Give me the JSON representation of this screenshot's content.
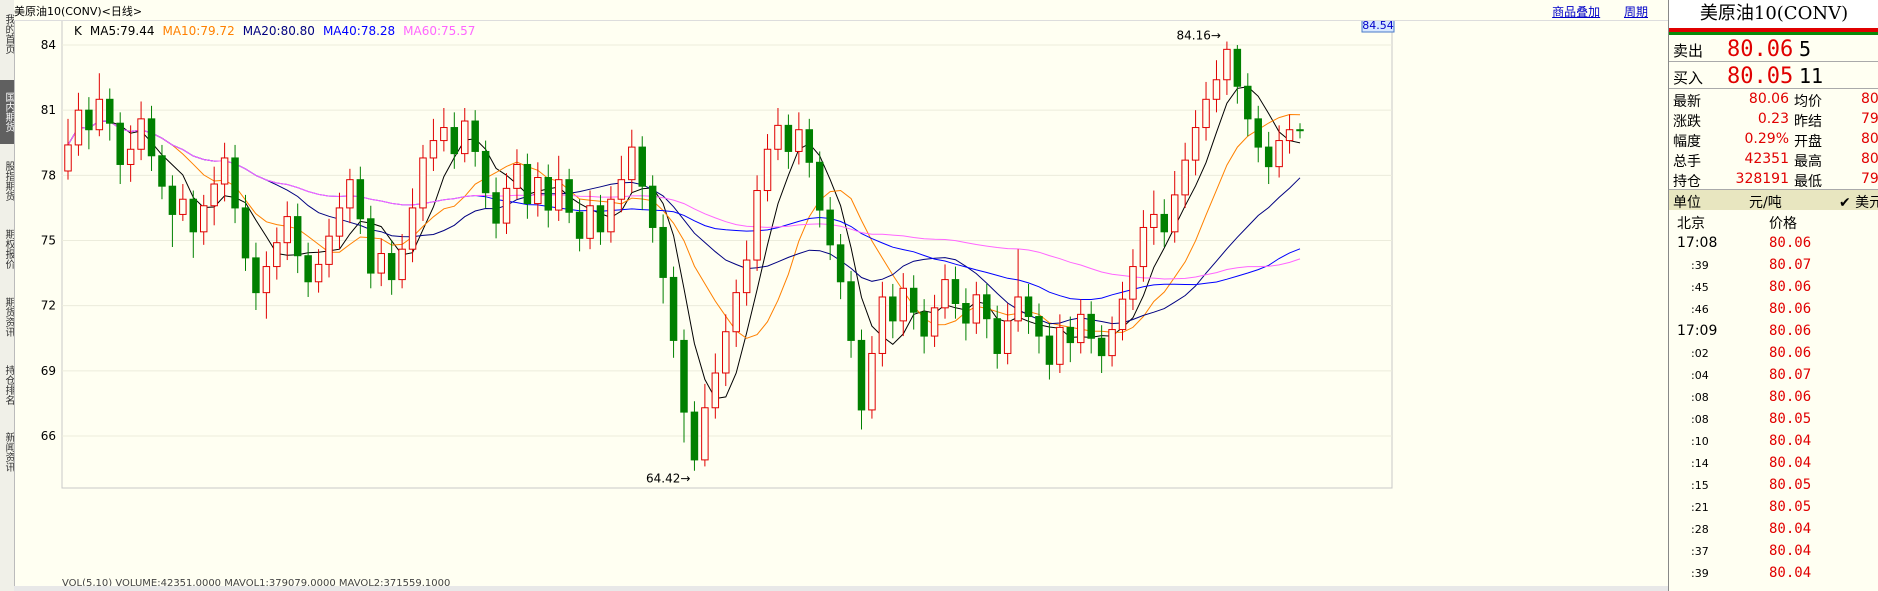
{
  "left_tabs": [
    {
      "label": "我的首页"
    },
    {
      "label": "国内期货",
      "active": true
    },
    {
      "label": "股指期货"
    },
    {
      "label": "期权报价"
    },
    {
      "label": "期货资讯"
    },
    {
      "label": "持仓排名"
    },
    {
      "label": "新闻资讯"
    }
  ],
  "header": {
    "title": "美原油10(CONV)<日线>",
    "links": [
      "商品叠加",
      "周期"
    ]
  },
  "ma_legend": [
    {
      "label": "K",
      "color": "#000000"
    },
    {
      "label": "MA5:79.44",
      "color": "#000000"
    },
    {
      "label": "MA10:79.72",
      "color": "#ff8000"
    },
    {
      "label": "MA20:80.80",
      "color": "#000080"
    },
    {
      "label": "MA40:78.28",
      "color": "#0000ff"
    },
    {
      "label": "MA60:75.57",
      "color": "#ff66ff"
    }
  ],
  "price_axis": {
    "ticks": [
      "84",
      "81",
      "78",
      "75",
      "72",
      "69",
      "66"
    ],
    "current_price_label": "84.54"
  },
  "annotations": {
    "high_label": "84.16",
    "low_label": "64.42"
  },
  "bottom_strip_text": "VOL(5,10) VOLUME:42351.0000 MAVOL1:379079.0000 MAVOL2:371559.1000",
  "colors": {
    "up": "#e00000",
    "down": "#008000",
    "accent_blue": "#0000c8"
  },
  "chart_data": {
    "type": "candlestick",
    "ylim": [
      64,
      85
    ],
    "yticks": [
      84,
      81,
      78,
      75,
      72,
      69,
      66
    ],
    "highest": 84.16,
    "lowest": 64.42,
    "candles": [
      [
        78.2,
        79.4,
        80.6,
        77.8
      ],
      [
        79.4,
        81.0,
        81.8,
        78.9
      ],
      [
        81.0,
        80.1,
        81.6,
        79.2
      ],
      [
        80.1,
        81.5,
        82.7,
        79.8
      ],
      [
        81.5,
        80.4,
        82.0,
        79.6
      ],
      [
        80.4,
        78.5,
        80.9,
        77.6
      ],
      [
        78.5,
        79.2,
        80.3,
        77.7
      ],
      [
        79.2,
        80.6,
        81.4,
        78.7
      ],
      [
        80.6,
        78.9,
        81.2,
        78.2
      ],
      [
        78.9,
        77.5,
        79.4,
        76.9
      ],
      [
        77.5,
        76.2,
        78.0,
        74.7
      ],
      [
        76.2,
        76.9,
        77.6,
        75.9
      ],
      [
        76.9,
        75.4,
        77.3,
        74.2
      ],
      [
        75.4,
        76.6,
        77.1,
        74.8
      ],
      [
        76.6,
        77.6,
        78.4,
        75.7
      ],
      [
        77.6,
        78.8,
        79.5,
        76.8
      ],
      [
        78.8,
        76.5,
        79.4,
        75.8
      ],
      [
        76.5,
        74.2,
        77.1,
        73.6
      ],
      [
        74.2,
        72.6,
        74.9,
        71.8
      ],
      [
        72.6,
        73.8,
        74.5,
        71.4
      ],
      [
        73.8,
        74.9,
        75.6,
        73.2
      ],
      [
        74.9,
        76.1,
        76.8,
        74.1
      ],
      [
        76.1,
        74.3,
        76.7,
        73.5
      ],
      [
        74.3,
        73.1,
        74.9,
        72.4
      ],
      [
        73.1,
        73.9,
        74.6,
        72.6
      ],
      [
        73.9,
        75.2,
        76.0,
        73.3
      ],
      [
        75.2,
        76.5,
        77.2,
        74.6
      ],
      [
        76.5,
        77.8,
        78.3,
        75.8
      ],
      [
        77.8,
        76.0,
        78.4,
        75.3
      ],
      [
        76.0,
        73.5,
        76.6,
        72.8
      ],
      [
        73.5,
        74.4,
        75.1,
        72.9
      ],
      [
        74.4,
        73.2,
        75.0,
        72.5
      ],
      [
        73.2,
        74.6,
        75.3,
        72.8
      ],
      [
        74.6,
        76.5,
        77.4,
        74.0
      ],
      [
        76.5,
        78.8,
        79.4,
        75.9
      ],
      [
        78.8,
        79.6,
        80.6,
        78.2
      ],
      [
        79.6,
        80.2,
        81.1,
        79.1
      ],
      [
        80.2,
        79.0,
        80.9,
        78.3
      ],
      [
        79.0,
        80.5,
        81.1,
        78.6
      ],
      [
        80.5,
        79.1,
        81.0,
        78.4
      ],
      [
        79.1,
        77.2,
        79.6,
        76.5
      ],
      [
        77.2,
        75.8,
        77.9,
        75.1
      ],
      [
        75.8,
        77.4,
        78.1,
        75.3
      ],
      [
        77.4,
        78.5,
        79.2,
        76.9
      ],
      [
        78.5,
        76.7,
        79.0,
        76.0
      ],
      [
        76.7,
        77.9,
        78.6,
        76.1
      ],
      [
        77.9,
        76.4,
        78.5,
        75.6
      ],
      [
        76.4,
        77.8,
        78.9,
        75.9
      ],
      [
        77.8,
        76.3,
        78.3,
        75.8
      ],
      [
        76.3,
        75.1,
        76.9,
        74.5
      ],
      [
        75.1,
        76.6,
        77.3,
        74.6
      ],
      [
        76.6,
        75.4,
        77.1,
        74.8
      ],
      [
        75.4,
        76.9,
        77.5,
        74.9
      ],
      [
        76.9,
        77.8,
        78.9,
        76.3
      ],
      [
        77.8,
        79.3,
        80.1,
        77.2
      ],
      [
        79.3,
        77.5,
        79.8,
        76.4
      ],
      [
        77.5,
        75.6,
        78.0,
        74.9
      ],
      [
        75.6,
        73.3,
        76.2,
        72.1
      ],
      [
        73.3,
        70.4,
        73.8,
        69.6
      ],
      [
        70.4,
        67.1,
        70.9,
        65.7
      ],
      [
        67.1,
        64.9,
        67.6,
        64.4
      ],
      [
        64.9,
        67.3,
        68.4,
        64.6
      ],
      [
        67.3,
        68.9,
        69.8,
        66.8
      ],
      [
        68.9,
        70.8,
        71.6,
        68.3
      ],
      [
        70.8,
        72.6,
        73.2,
        70.1
      ],
      [
        72.6,
        74.1,
        75.0,
        72.0
      ],
      [
        74.1,
        77.3,
        78.0,
        73.6
      ],
      [
        77.3,
        79.2,
        79.9,
        76.8
      ],
      [
        79.2,
        80.3,
        81.1,
        78.7
      ],
      [
        80.3,
        79.1,
        80.8,
        78.3
      ],
      [
        79.1,
        80.1,
        80.9,
        78.5
      ],
      [
        80.1,
        78.6,
        80.6,
        77.9
      ],
      [
        78.6,
        76.4,
        79.1,
        75.6
      ],
      [
        76.4,
        74.8,
        77.0,
        74.1
      ],
      [
        74.8,
        73.1,
        75.3,
        72.3
      ],
      [
        73.1,
        70.4,
        73.6,
        69.6
      ],
      [
        70.4,
        67.2,
        70.9,
        66.3
      ],
      [
        67.2,
        69.8,
        70.6,
        66.8
      ],
      [
        69.8,
        72.4,
        73.1,
        69.2
      ],
      [
        72.4,
        71.3,
        73.0,
        70.5
      ],
      [
        71.3,
        72.8,
        73.5,
        70.6
      ],
      [
        72.8,
        71.7,
        73.4,
        70.9
      ],
      [
        71.7,
        70.6,
        72.3,
        69.8
      ],
      [
        70.6,
        71.9,
        72.5,
        70.1
      ],
      [
        71.9,
        73.2,
        73.9,
        71.4
      ],
      [
        73.2,
        72.1,
        73.8,
        71.4
      ],
      [
        72.1,
        71.2,
        72.8,
        70.4
      ],
      [
        71.2,
        72.5,
        73.1,
        70.7
      ],
      [
        72.5,
        71.4,
        73.0,
        70.5
      ],
      [
        71.4,
        69.8,
        72.0,
        69.1
      ],
      [
        69.8,
        71.3,
        72.1,
        69.3
      ],
      [
        71.3,
        72.4,
        74.6,
        70.8
      ],
      [
        72.4,
        71.5,
        73.0,
        70.7
      ],
      [
        71.5,
        70.6,
        72.1,
        69.8
      ],
      [
        70.6,
        69.3,
        71.2,
        68.6
      ],
      [
        69.3,
        71.0,
        71.6,
        68.9
      ],
      [
        71.0,
        70.3,
        71.5,
        69.4
      ],
      [
        70.3,
        71.6,
        72.3,
        69.8
      ],
      [
        71.6,
        70.5,
        72.2,
        69.8
      ],
      [
        70.5,
        69.7,
        71.1,
        68.9
      ],
      [
        69.7,
        70.9,
        71.5,
        69.2
      ],
      [
        70.9,
        72.3,
        73.1,
        70.4
      ],
      [
        72.3,
        73.8,
        74.6,
        71.8
      ],
      [
        73.8,
        75.6,
        76.4,
        73.1
      ],
      [
        75.6,
        76.2,
        77.3,
        74.8
      ],
      [
        76.2,
        75.4,
        76.9,
        74.7
      ],
      [
        75.4,
        77.1,
        78.2,
        74.9
      ],
      [
        77.1,
        78.7,
        79.5,
        76.5
      ],
      [
        78.7,
        80.2,
        81.0,
        78.0
      ],
      [
        80.2,
        81.5,
        82.3,
        79.6
      ],
      [
        81.5,
        82.4,
        83.3,
        80.9
      ],
      [
        82.4,
        83.8,
        84.16,
        81.7
      ],
      [
        83.8,
        82.1,
        84.0,
        81.3
      ],
      [
        82.1,
        80.6,
        82.7,
        79.8
      ],
      [
        80.6,
        79.3,
        81.2,
        78.6
      ],
      [
        79.3,
        78.4,
        80.0,
        77.6
      ],
      [
        78.4,
        79.6,
        80.3,
        77.9
      ],
      [
        79.6,
        80.1,
        80.8,
        79.0
      ],
      [
        80.1,
        80.06,
        80.4,
        79.7
      ]
    ]
  },
  "quote": {
    "symbol": "美原油10(CONV)",
    "sell": {
      "label": "卖出",
      "price": "80.06",
      "vol": "5"
    },
    "buy": {
      "label": "买入",
      "price": "80.05",
      "vol": "11"
    },
    "stats": [
      {
        "l1": "最新",
        "v1": "80.06",
        "l2": "均价",
        "v2": "80"
      },
      {
        "l1": "涨跌",
        "v1": "0.23",
        "l2": "昨结",
        "v2": "79"
      },
      {
        "l1": "幅度",
        "v1": "0.29%",
        "l2": "开盘",
        "v2": "80"
      },
      {
        "l1": "总手",
        "v1": "42351",
        "l2": "最高",
        "v2": "80"
      },
      {
        "l1": "持仓",
        "v1": "328191",
        "l2": "最低",
        "v2": "79"
      }
    ],
    "unit_label": "单位",
    "unit_value": "元/吨",
    "currency": "✔ 美元",
    "city": "北京",
    "price_header": "价格",
    "ticks": [
      {
        "t": "17:08",
        "p": "80.06",
        "small": false
      },
      {
        "t": ":39",
        "p": "80.07",
        "small": true
      },
      {
        "t": ":45",
        "p": "80.06",
        "small": true
      },
      {
        "t": ":46",
        "p": "80.06",
        "small": true
      },
      {
        "t": "17:09",
        "p": "80.06",
        "small": false
      },
      {
        "t": ":02",
        "p": "80.06",
        "small": true
      },
      {
        "t": ":04",
        "p": "80.07",
        "small": true
      },
      {
        "t": ":08",
        "p": "80.06",
        "small": true
      },
      {
        "t": ":08",
        "p": "80.05",
        "small": true
      },
      {
        "t": ":10",
        "p": "80.04",
        "small": true
      },
      {
        "t": ":14",
        "p": "80.04",
        "small": true
      },
      {
        "t": ":15",
        "p": "80.05",
        "small": true
      },
      {
        "t": ":21",
        "p": "80.05",
        "small": true
      },
      {
        "t": ":28",
        "p": "80.04",
        "small": true
      },
      {
        "t": ":37",
        "p": "80.04",
        "small": true
      },
      {
        "t": ":39",
        "p": "80.04",
        "small": true
      }
    ]
  }
}
